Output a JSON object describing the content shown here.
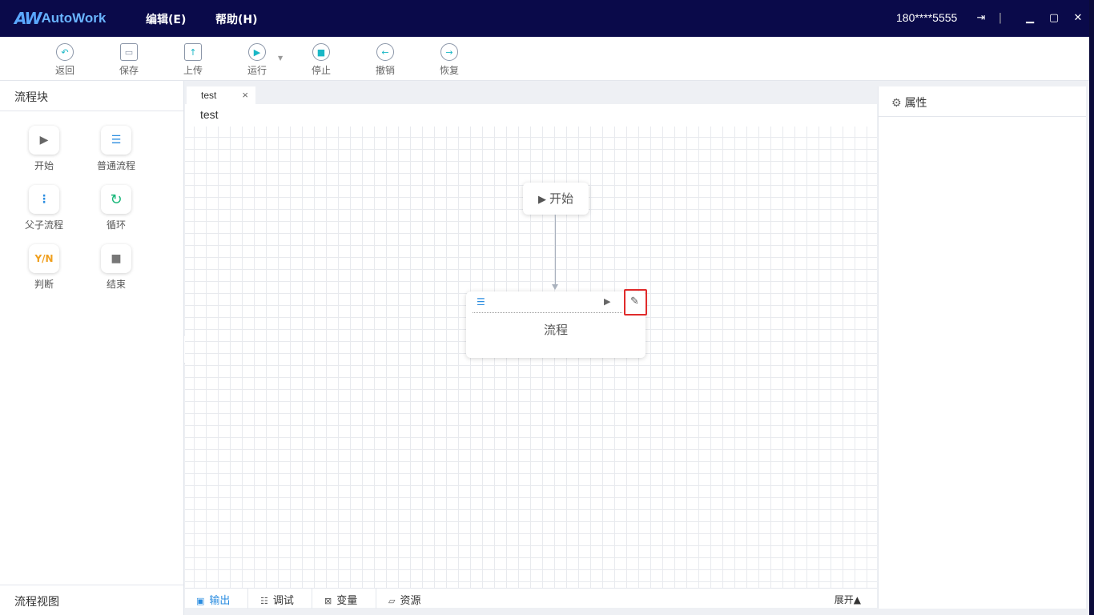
{
  "app": {
    "logo_mark": "AW",
    "logo_text": "AutoWork",
    "menu": {
      "edit": "编辑(E)",
      "help": "帮助(H)"
    },
    "user": "180****5555",
    "window_controls": {
      "logout": "⇥",
      "separator": "|",
      "minimize": "▁",
      "maximize": "▢",
      "close": "✕"
    }
  },
  "toolbar": [
    {
      "label": "返回",
      "icon": "back-icon",
      "glyph": "↶"
    },
    {
      "label": "保存",
      "icon": "save-icon",
      "glyph": "▭"
    },
    {
      "label": "上传",
      "icon": "upload-icon",
      "glyph": "↑"
    },
    {
      "label": "运行",
      "icon": "run-icon",
      "glyph": "▶"
    },
    {
      "label": "停止",
      "icon": "stop-icon",
      "glyph": "■"
    },
    {
      "label": "撤销",
      "icon": "undo-icon",
      "glyph": "←"
    },
    {
      "label": "恢复",
      "icon": "redo-icon",
      "glyph": "→"
    }
  ],
  "left_panel": {
    "title": "流程块",
    "blocks": [
      {
        "label": "开始",
        "glyph": "▶",
        "color": "#666666"
      },
      {
        "label": "普通流程",
        "glyph": "☰",
        "color": "#2b8de0"
      },
      {
        "label": "父子流程",
        "glyph": "⋮",
        "color": "#2b8de0"
      },
      {
        "label": "循环",
        "glyph": "↻",
        "color": "#19b77a"
      },
      {
        "label": "判断",
        "glyph": "Y/N",
        "color": "#f0a020"
      },
      {
        "label": "结束",
        "glyph": "■",
        "color": "#777777"
      }
    ],
    "footer": "流程视图",
    "collapse": "«"
  },
  "editor": {
    "tab_label": "test",
    "tab_close": "×",
    "title": "test",
    "start_node": {
      "glyph": "▶",
      "label": "开始"
    },
    "flow_node": {
      "list_glyph": "☰",
      "run_glyph": "▶",
      "edit_glyph": "✎",
      "label": "流程"
    }
  },
  "bottom_tabs": [
    {
      "label": "输出",
      "glyph": "▣",
      "active": true
    },
    {
      "label": "调试",
      "glyph": "☷",
      "active": false
    },
    {
      "label": "变量",
      "glyph": "⊠",
      "active": false
    },
    {
      "label": "资源",
      "glyph": "▱",
      "active": false
    }
  ],
  "expand_label": "展开▲",
  "right_panel": {
    "title": "属性",
    "gear": "⚙"
  },
  "colors": {
    "title_bar": "#0a0a4a",
    "accent": "#2b8de0",
    "highlight": "#e02b2b",
    "teal": "#19b7c6"
  }
}
